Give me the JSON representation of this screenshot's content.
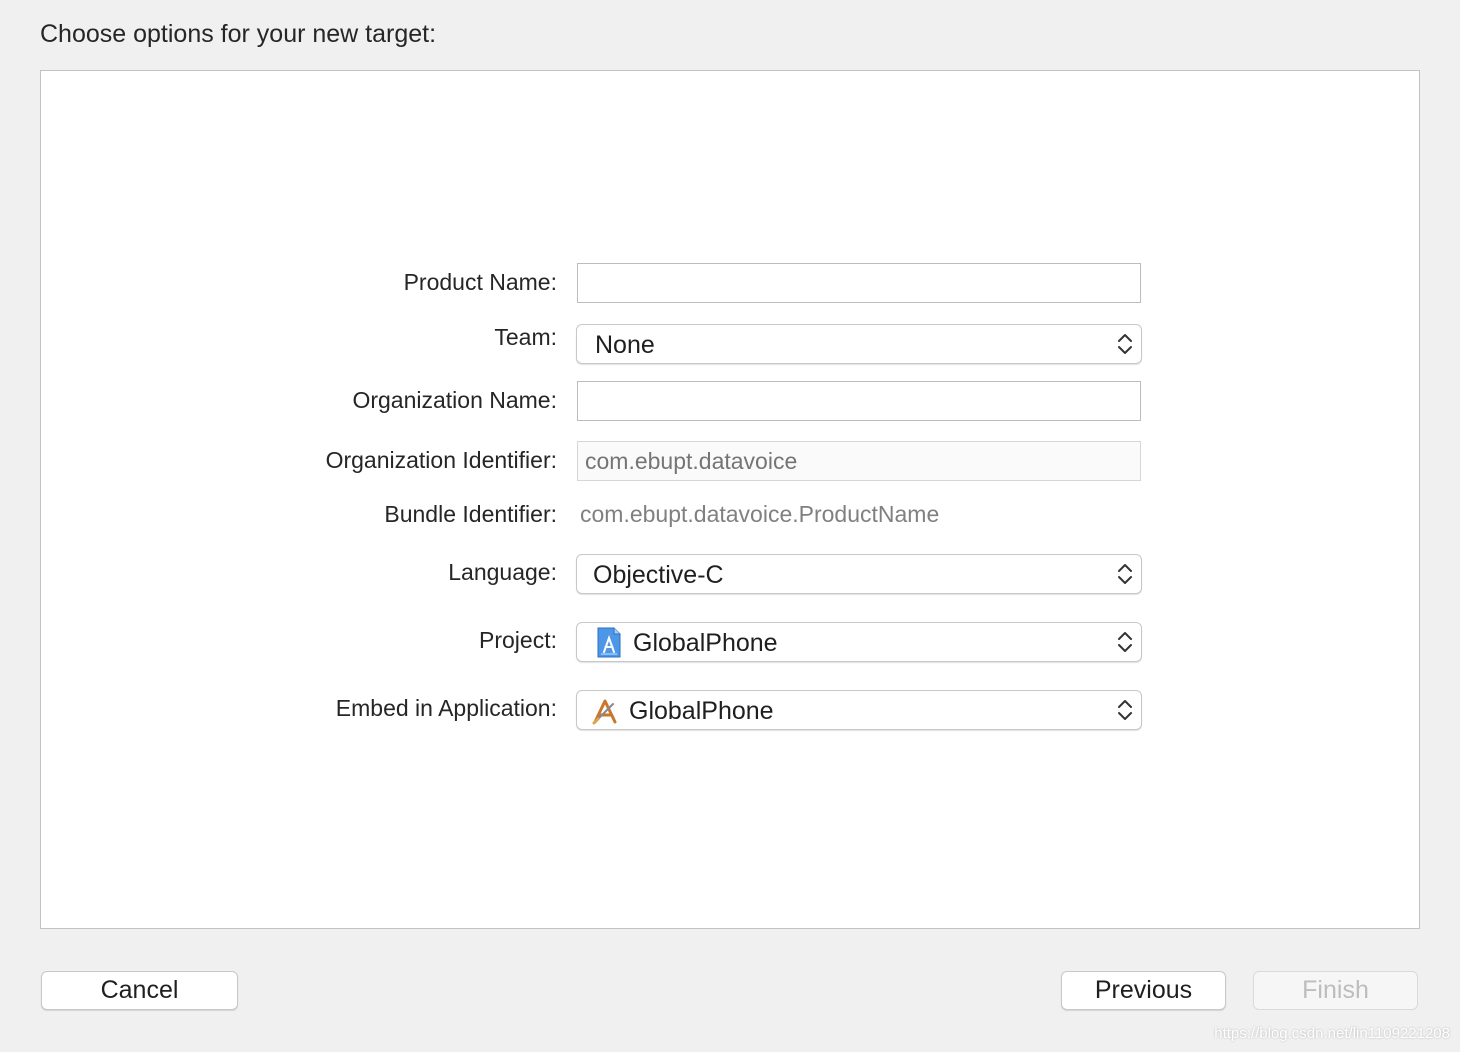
{
  "dialog": {
    "title": "Choose options for your new target:"
  },
  "form": {
    "product_name": {
      "label": "Product Name:",
      "value": ""
    },
    "team": {
      "label": "Team:",
      "selected": "None"
    },
    "organization_name": {
      "label": "Organization Name:",
      "value": ""
    },
    "organization_identifier": {
      "label": "Organization Identifier:",
      "placeholder": "com.ebupt.datavoice"
    },
    "bundle_identifier": {
      "label": "Bundle Identifier:",
      "value": "com.ebupt.datavoice.ProductName"
    },
    "language": {
      "label": "Language:",
      "selected": "Objective-C"
    },
    "project": {
      "label": "Project:",
      "selected": "GlobalPhone",
      "icon": "xcode-project-icon"
    },
    "embed_in_application": {
      "label": "Embed in Application:",
      "selected": "GlobalPhone",
      "icon": "app-icon"
    }
  },
  "buttons": {
    "cancel": "Cancel",
    "previous": "Previous",
    "finish": "Finish"
  },
  "watermark": "https://blog.csdn.net/lin1109221208",
  "colors": {
    "window_background": "#f0f0f0",
    "panel_background": "#ffffff",
    "disabled_text": "#bdbdbd",
    "secondary_text": "#808080"
  }
}
